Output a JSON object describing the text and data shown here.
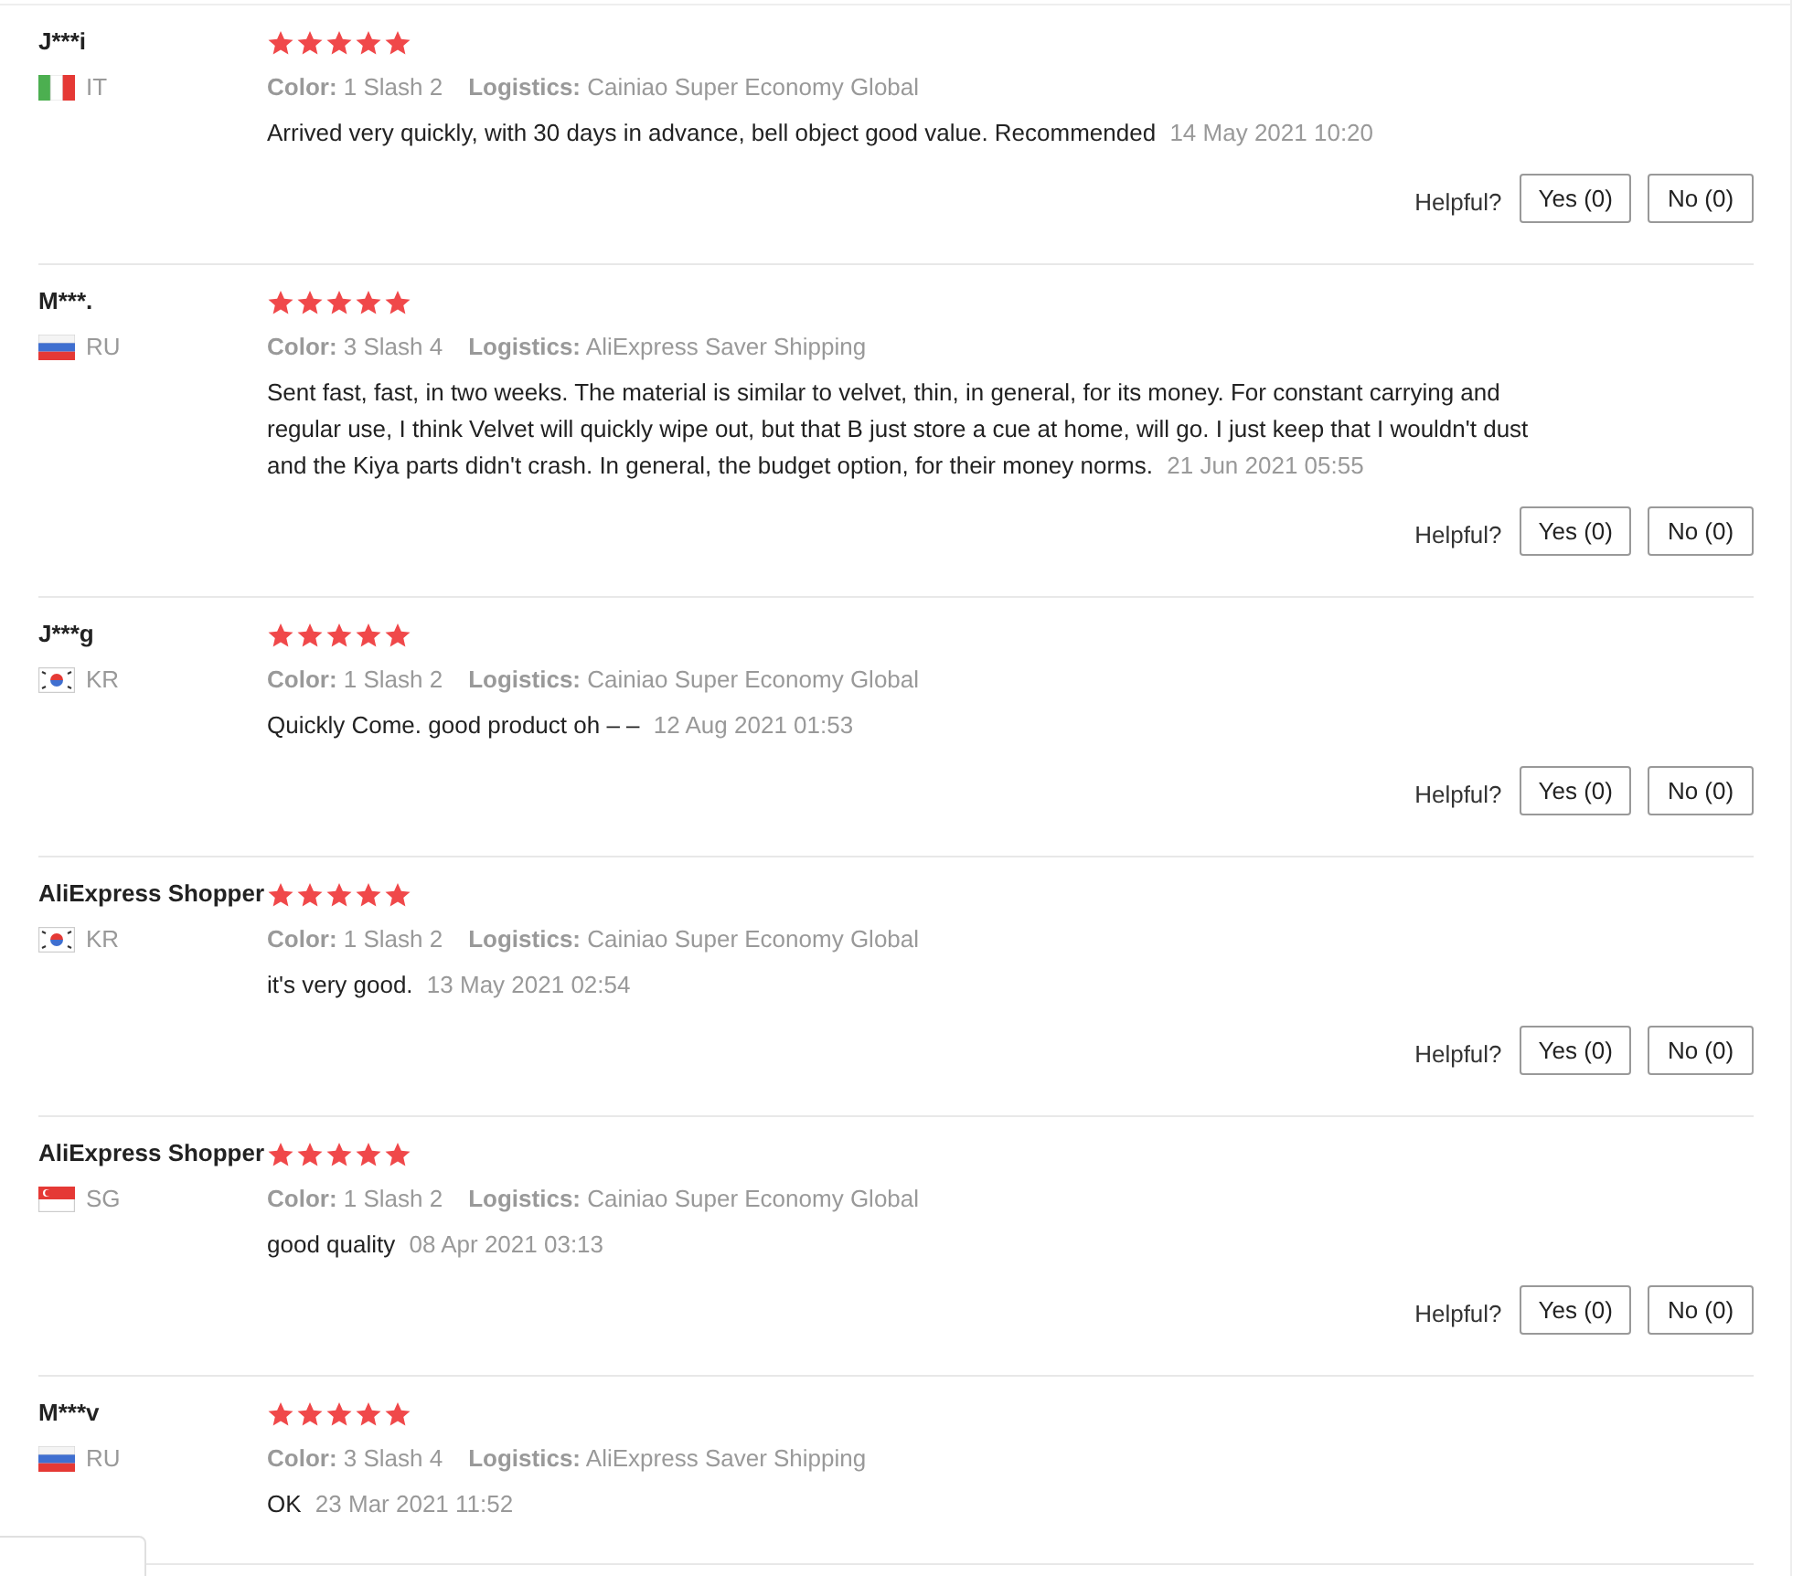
{
  "reviews": [
    {
      "user": "J***i",
      "country": "IT",
      "flag": {
        "kind": "tricolor-vertical"
      },
      "stars": 5,
      "color_label": "Color:",
      "color_value": "1 Slash 2",
      "logistics_label": "Logistics:",
      "logistics_value": "Cainiao Super Economy Global",
      "text": "Arrived very quickly, with 30 days in advance, bell object good value. Recommended",
      "date": "14 May 2021 10:20",
      "helpful_label": "Helpful?",
      "yes": "Yes (0)",
      "no": "No (0)"
    },
    {
      "user": "M***.",
      "country": "RU",
      "flag": {
        "kind": "tricolor-horizontal"
      },
      "stars": 5,
      "color_label": "Color:",
      "color_value": "3 Slash 4",
      "logistics_label": "Logistics:",
      "logistics_value": "AliExpress Saver Shipping",
      "text": "Sent fast, fast, in two weeks. The material is similar to velvet, thin, in general, for its money. For constant carrying and regular use, I think Velvet will quickly wipe out, but that B just store a cue at home, will go. I just keep that I wouldn't dust and the Kiya parts didn't crash. In general, the budget option, for their money norms.",
      "date": "21 Jun 2021 05:55",
      "helpful_label": "Helpful?",
      "yes": "Yes (0)",
      "no": "No (0)"
    },
    {
      "user": "J***g",
      "country": "KR",
      "flag": {
        "kind": "taegeuk"
      },
      "stars": 5,
      "color_label": "Color:",
      "color_value": "1 Slash 2",
      "logistics_label": "Logistics:",
      "logistics_value": "Cainiao Super Economy Global",
      "text": "Quickly Come. good product oh – –",
      "date": "12 Aug 2021 01:53",
      "helpful_label": "Helpful?",
      "yes": "Yes (0)",
      "no": "No (0)"
    },
    {
      "user": "AliExpress Shopper",
      "country": "KR",
      "flag": {
        "kind": "taegeuk"
      },
      "stars": 5,
      "color_label": "Color:",
      "color_value": "1 Slash 2",
      "logistics_label": "Logistics:",
      "logistics_value": "Cainiao Super Economy Global",
      "text": "it's very good.",
      "date": "13 May 2021 02:54",
      "helpful_label": "Helpful?",
      "yes": "Yes (0)",
      "no": "No (0)"
    },
    {
      "user": "AliExpress Shopper",
      "country": "SG",
      "flag": {
        "kind": "bicolor-crescent"
      },
      "stars": 5,
      "color_label": "Color:",
      "color_value": "1 Slash 2",
      "logistics_label": "Logistics:",
      "logistics_value": "Cainiao Super Economy Global",
      "text": "good quality",
      "date": "08 Apr 2021 03:13",
      "helpful_label": "Helpful?",
      "yes": "Yes (0)",
      "no": "No (0)"
    },
    {
      "user": "M***v",
      "country": "RU",
      "flag": {
        "kind": "tricolor-horizontal"
      },
      "stars": 5,
      "color_label": "Color:",
      "color_value": "3 Slash 4",
      "logistics_label": "Logistics:",
      "logistics_value": "AliExpress Saver Shipping",
      "text": "OK",
      "date": "23 Mar 2021 11:52"
    }
  ]
}
